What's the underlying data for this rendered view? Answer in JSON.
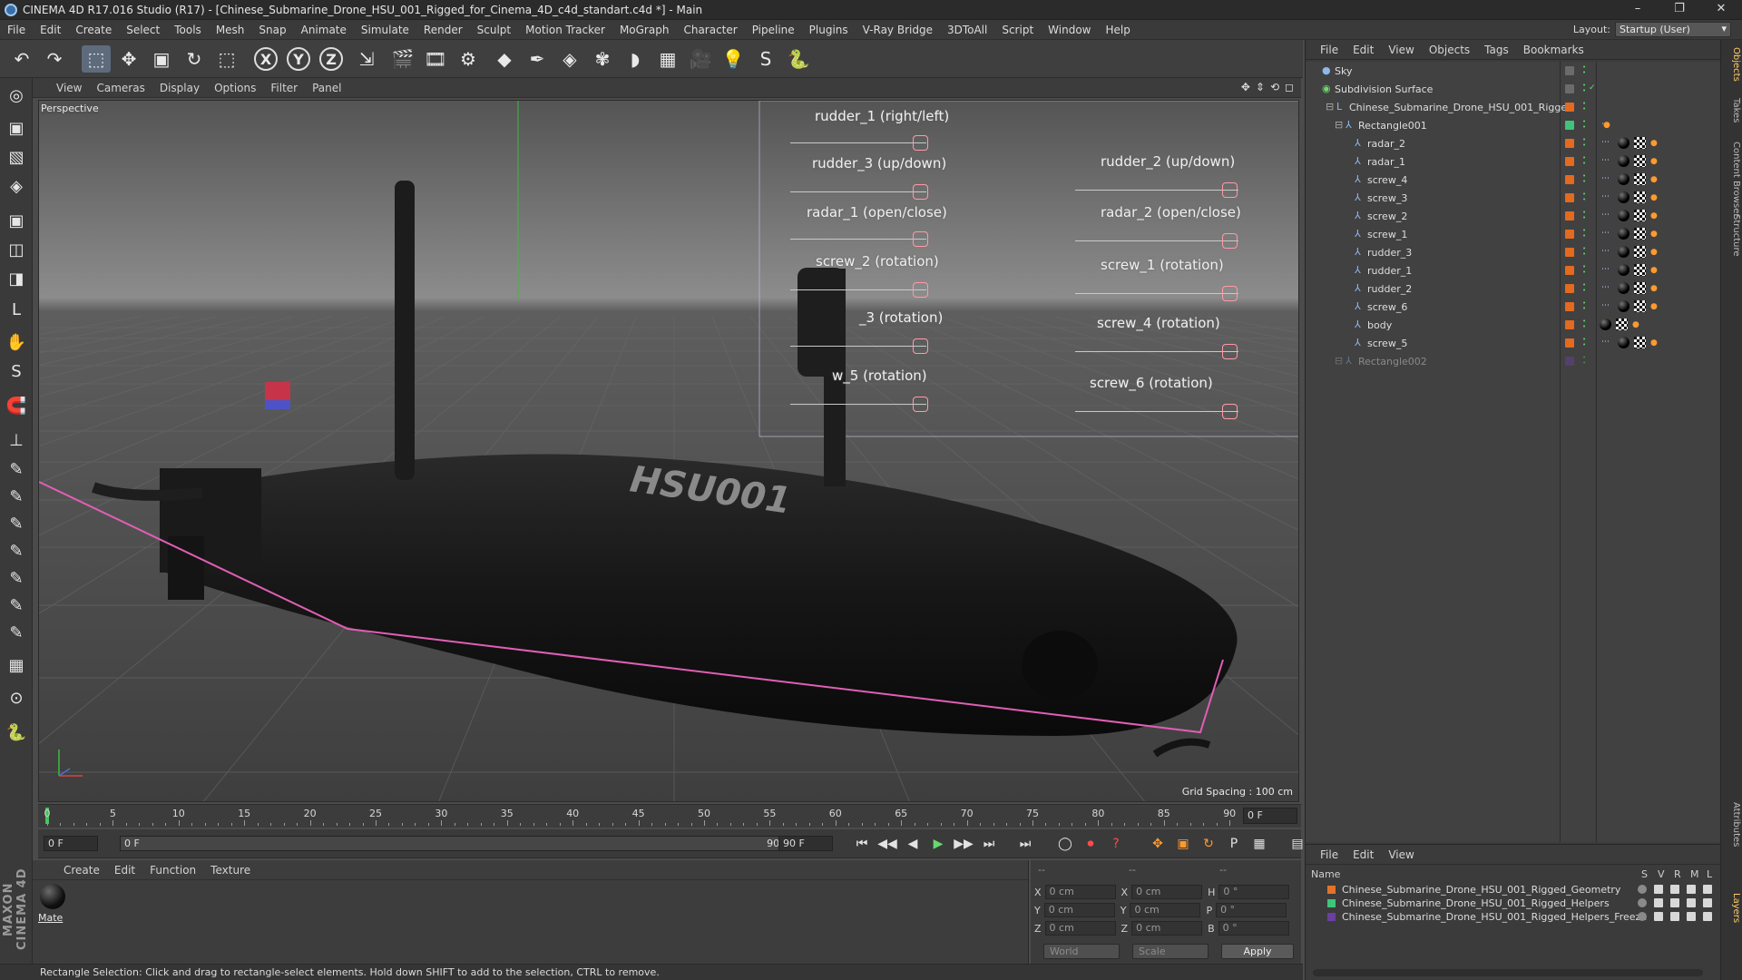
{
  "window": {
    "title": "CINEMA 4D R17.016 Studio (R17) - [Chinese_Submarine_Drone_HSU_001_Rigged_for_Cinema_4D_c4d_standart.c4d *] - Main",
    "controls": [
      "–",
      "❐",
      "✕"
    ]
  },
  "menubar": {
    "items": [
      "File",
      "Edit",
      "Create",
      "Select",
      "Tools",
      "Mesh",
      "Snap",
      "Animate",
      "Simulate",
      "Render",
      "Sculpt",
      "Motion Tracker",
      "MoGraph",
      "Character",
      "Pipeline",
      "Plugins",
      "V-Ray Bridge",
      "3DToAll",
      "Script",
      "Window",
      "Help"
    ],
    "layout_label": "Layout:",
    "layout_value": "Startup (User)"
  },
  "toolbar": {
    "icons": [
      "undo-icon",
      "redo-icon",
      "live-select-icon",
      "move-icon",
      "scale-icon",
      "rotate-icon",
      "rect-select-icon",
      "x-axis-icon",
      "y-axis-icon",
      "z-axis-icon",
      "world-coord-icon",
      "render-view-icon",
      "render-picture-queue-icon",
      "render-settings-icon",
      "cube-icon",
      "pen-icon",
      "subdivision-icon",
      "array-icon",
      "deformer-icon",
      "floor-icon",
      "camera-icon",
      "light-icon",
      "snap-icon",
      "python-icon"
    ],
    "glyphs": [
      "↶",
      "↷",
      "⬚",
      "✥",
      "▣",
      "↻",
      "⬚",
      "X",
      "Y",
      "Z",
      "⇲",
      "🎬",
      "🎞",
      "⚙",
      "◆",
      "✒",
      "◈",
      "✾",
      "◗",
      "▦",
      "🎥",
      "💡",
      "S",
      "🐍"
    ]
  },
  "lefttools": {
    "glyphs": [
      "◎",
      "▣",
      "▧",
      "◈",
      "▣",
      "◫",
      "◨",
      "L",
      "✋",
      "S",
      "🧲",
      "⊥",
      "✎",
      "✎",
      "✎",
      "✎",
      "✎",
      "✎",
      "✎",
      "▦",
      "⊙",
      "🐍"
    ],
    "names": [
      "model-mode-icon",
      "object-mode-icon",
      "texture-mode-icon",
      "workplane-icon",
      "points-mode-icon",
      "edges-mode-icon",
      "polygons-mode-icon",
      "axis-mode-icon",
      "tweak-icon",
      "snap-mode-icon",
      "magnet-icon",
      "axis-lock-icon",
      "sculpt-brush-icon",
      "sculpt-smooth-icon",
      "sculpt-pull-icon",
      "sculpt-flatten-icon",
      "sculpt-inflate-icon",
      "sculpt-pinch-icon",
      "sculpt-mask-icon",
      "grid-lock-icon",
      "solo-icon",
      "python-console-icon"
    ],
    "logo": "MAXON CINEMA 4D"
  },
  "viewport": {
    "menu": [
      "View",
      "Cameras",
      "Display",
      "Options",
      "Filter",
      "Panel"
    ],
    "nav_icons": [
      "✥",
      "⇕",
      "⟲",
      "◻"
    ],
    "label": "Perspective",
    "grid_spacing": "Grid Spacing : 100 cm",
    "hull_text": "HSU001",
    "controls": [
      {
        "label": "rudder_1 (right/left)",
        "value": 0.9
      },
      {
        "label": "rudder_3 (up/down)",
        "value": 0.9
      },
      {
        "label": "radar_1 (open/close)",
        "value": 0.9
      },
      {
        "label": "screw_2 (rotation)",
        "value": 0.9
      },
      {
        "label": "_3 (rotation)",
        "value": 0.9
      },
      {
        "label": "w_5 (rotation)",
        "value": 0.9
      },
      {
        "label": "rudder_2 (up/down)",
        "value": 0.9
      },
      {
        "label": "radar_2 (open/close)",
        "value": 0.9
      },
      {
        "label": "screw_1 (rotation)",
        "value": 0.9
      },
      {
        "label": "screw_4 (rotation)",
        "value": 0.9
      },
      {
        "label": "screw_6 (rotation)",
        "value": 0.9
      }
    ],
    "axis": {
      "x": "x",
      "y": "y",
      "z": "z"
    }
  },
  "timeline": {
    "ticks": [
      0,
      5,
      10,
      15,
      20,
      25,
      30,
      35,
      40,
      45,
      50,
      55,
      60,
      65,
      70,
      75,
      80,
      85,
      90
    ],
    "current_frame": "0 F"
  },
  "transport": {
    "start_field": "0 F",
    "range_start": "0 F",
    "range_end": "90 F",
    "end_field": "90 F",
    "buttons": [
      "⏮",
      "◀◀",
      "◀",
      "▶",
      "▶▶",
      "⏭",
      "⏭"
    ],
    "record_buttons": [
      "◯",
      "⏺",
      "?"
    ],
    "key_buttons": [
      "✥",
      "▣",
      "↻",
      "P",
      "▦",
      "▤"
    ]
  },
  "material_manager": {
    "menu": [
      "Create",
      "Edit",
      "Function",
      "Texture"
    ],
    "materials": [
      {
        "name": "Mate"
      }
    ]
  },
  "coordinates": {
    "header_left": "--",
    "header_mid": "--",
    "header_right": "--",
    "rows": [
      {
        "a": "X",
        "av": "0 cm",
        "b": "X",
        "bv": "0 cm",
        "c": "H",
        "cv": "0 °"
      },
      {
        "a": "Y",
        "av": "0 cm",
        "b": "Y",
        "bv": "0 cm",
        "c": "P",
        "cv": "0 °"
      },
      {
        "a": "Z",
        "av": "0 cm",
        "b": "Z",
        "bv": "0 cm",
        "c": "B",
        "cv": "0 °"
      }
    ],
    "mode_world": "World",
    "mode_scale": "Scale",
    "apply": "Apply"
  },
  "status": {
    "text": "Rectangle Selection: Click and drag to rectangle-select elements. Hold down SHIFT to add to the selection, CTRL to remove."
  },
  "object_manager": {
    "menu": [
      "File",
      "Edit",
      "View",
      "Objects",
      "Tags",
      "Bookmarks"
    ],
    "objects": [
      {
        "name": "Sky",
        "indent": 0,
        "layer": false,
        "tags": "none"
      },
      {
        "name": "Subdivision Surface",
        "indent": 0,
        "layer": false,
        "tags": "check"
      },
      {
        "name": "Chinese_Submarine_Drone_HSU_001_Rigged",
        "indent": 1,
        "layer": true,
        "tags": "none"
      },
      {
        "name": "Rectangle001",
        "indent": 2,
        "layer": "green",
        "tags": "dot"
      },
      {
        "name": "radar_2",
        "indent": 3,
        "layer": true,
        "tags": "full"
      },
      {
        "name": "radar_1",
        "indent": 3,
        "layer": true,
        "tags": "full"
      },
      {
        "name": "screw_4",
        "indent": 3,
        "layer": true,
        "tags": "full"
      },
      {
        "name": "screw_3",
        "indent": 3,
        "layer": true,
        "tags": "full"
      },
      {
        "name": "screw_2",
        "indent": 3,
        "layer": true,
        "tags": "full"
      },
      {
        "name": "screw_1",
        "indent": 3,
        "layer": true,
        "tags": "full"
      },
      {
        "name": "rudder_3",
        "indent": 3,
        "layer": true,
        "tags": "full"
      },
      {
        "name": "rudder_1",
        "indent": 3,
        "layer": true,
        "tags": "full"
      },
      {
        "name": "rudder_2",
        "indent": 3,
        "layer": true,
        "tags": "full"
      },
      {
        "name": "screw_6",
        "indent": 3,
        "layer": true,
        "tags": "full"
      },
      {
        "name": "body",
        "indent": 3,
        "layer": true,
        "tags": "body"
      },
      {
        "name": "screw_5",
        "indent": 3,
        "layer": true,
        "tags": "full"
      },
      {
        "name": "Rectangle002",
        "indent": 2,
        "layer": "purple",
        "tags": "faded"
      }
    ]
  },
  "layer_manager": {
    "menu": [
      "File",
      "Edit",
      "View"
    ],
    "header_name": "Name",
    "header_cols": [
      "S",
      "V",
      "R",
      "M",
      "L"
    ],
    "layers": [
      {
        "name": "Chinese_Submarine_Drone_HSU_001_Rigged_Geometry",
        "color": "#e3722a"
      },
      {
        "name": "Chinese_Submarine_Drone_HSU_001_Rigged_Helpers",
        "color": "#3fc47a"
      },
      {
        "name": "Chinese_Submarine_Drone_HSU_001_Rigged_Helpers_Freeze",
        "color": "#6a3fa0"
      }
    ]
  },
  "side_tabs": [
    "Objects",
    "Takes",
    "Content Browser",
    "Structure",
    "Attributes",
    "Layers"
  ],
  "colors": {
    "accent": "#5d6b7c",
    "selection": "#e05fb5",
    "layer_orange": "#e3722a",
    "play": "#68d86f"
  }
}
